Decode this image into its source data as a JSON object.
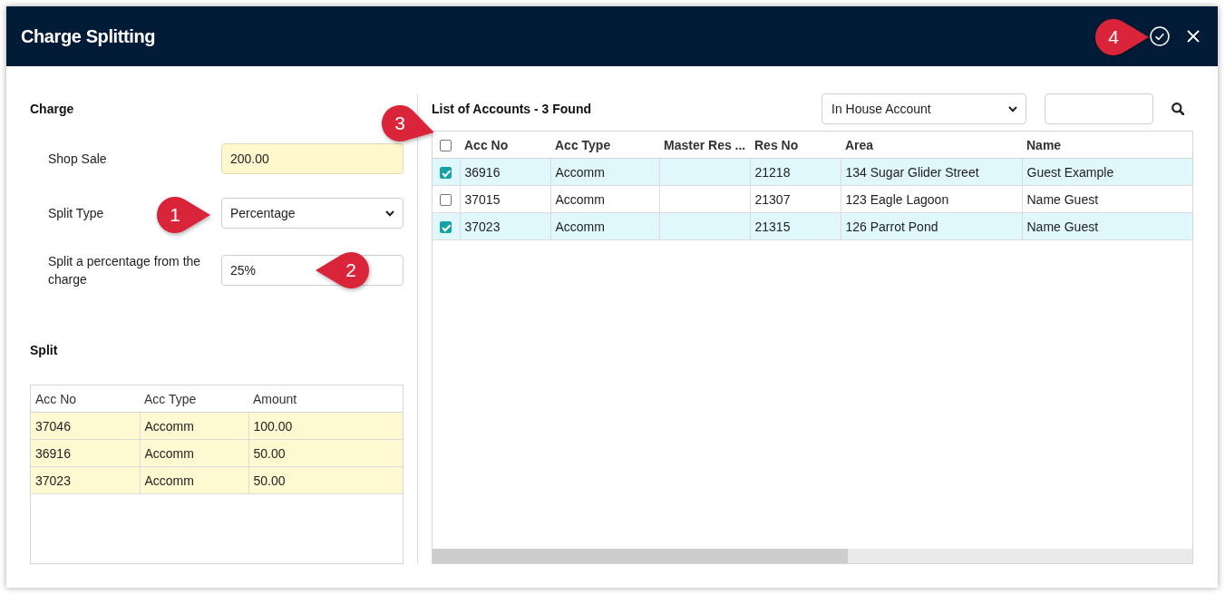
{
  "dialog": {
    "title": "Charge Splitting",
    "confirm_button": {
      "callout": "4"
    }
  },
  "charge": {
    "heading": "Charge",
    "fields": [
      {
        "kind": "input",
        "label": "Shop Sale",
        "value": "200.00",
        "readonly": true
      },
      {
        "kind": "select",
        "label": "Split Type",
        "value": "Percentage",
        "readonly": false,
        "callout": "1"
      },
      {
        "kind": "input",
        "label": "Split a percentage from the charge",
        "value": "25%",
        "readonly": false,
        "callout": "2"
      }
    ]
  },
  "split": {
    "heading": "Split",
    "columns": [
      "Acc No",
      "Acc Type",
      "Amount"
    ],
    "rows": [
      [
        "37046",
        "Accomm",
        "100.00"
      ],
      [
        "36916",
        "Accomm",
        "50.00"
      ],
      [
        "37023",
        "Accomm",
        "50.00"
      ]
    ]
  },
  "accounts": {
    "heading": "List of Accounts - 3 Found",
    "callout": "3",
    "filter": {
      "value": "In House Account"
    },
    "columns": [
      "Acc No",
      "Acc Type",
      "Master Res ...",
      "Res No",
      "Area",
      "Name"
    ],
    "select_all": {
      "checked": false
    },
    "rows": [
      {
        "checked": true,
        "cells": [
          "36916",
          "Accomm",
          null,
          "21218",
          "134 Sugar Glider Street",
          "Guest Example"
        ]
      },
      {
        "checked": false,
        "cells": [
          "37015",
          "Accomm",
          null,
          "21307",
          "123 Eagle Lagoon",
          "Name Guest"
        ]
      },
      {
        "checked": true,
        "cells": [
          "37023",
          "Accomm",
          null,
          "21315",
          "126 Parrot Pond",
          "Name Guest"
        ]
      }
    ]
  }
}
